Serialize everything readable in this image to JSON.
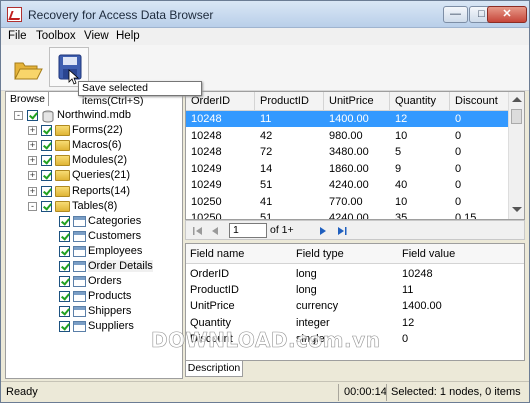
{
  "window": {
    "title": "Recovery for Access Data Browser"
  },
  "menu": [
    "File",
    "Toolbox",
    "View",
    "Help"
  ],
  "toolbar": {
    "tooltip": "Save selected items(Ctrl+S)"
  },
  "left_panel": {
    "tab": "Browse",
    "root": "Northwind.mdb",
    "groups": [
      "Forms(22)",
      "Macros(6)",
      "Modules(2)",
      "Queries(21)",
      "Reports(14)",
      "Tables(8)"
    ],
    "tables": [
      "Categories",
      "Customers",
      "Employees",
      "Order Details",
      "Orders",
      "Products",
      "Shippers",
      "Suppliers"
    ]
  },
  "grid": {
    "columns": [
      "OrderID",
      "ProductID",
      "UnitPrice",
      "Quantity",
      "Discount"
    ],
    "rows": [
      [
        "10248",
        "11",
        "1400.00",
        "12",
        "0"
      ],
      [
        "10248",
        "42",
        "980.00",
        "10",
        "0"
      ],
      [
        "10248",
        "72",
        "3480.00",
        "5",
        "0"
      ],
      [
        "10249",
        "14",
        "1860.00",
        "9",
        "0"
      ],
      [
        "10249",
        "51",
        "4240.00",
        "40",
        "0"
      ],
      [
        "10250",
        "41",
        "770.00",
        "10",
        "0"
      ],
      [
        "10250",
        "51",
        "4240.00",
        "35",
        "0.15"
      ]
    ]
  },
  "pager": {
    "page": "1",
    "of_label": "of 1+"
  },
  "fields": {
    "headers": [
      "Field name",
      "Field type",
      "Field value"
    ],
    "rows": [
      [
        "OrderID",
        "long",
        "10248"
      ],
      [
        "ProductID",
        "long",
        "11"
      ],
      [
        "UnitPrice",
        "currency",
        "1400.00"
      ],
      [
        "Quantity",
        "integer",
        "12"
      ],
      [
        "Discount",
        "single",
        "0"
      ]
    ]
  },
  "bottom_tab": "Description",
  "status": {
    "left": "Ready",
    "time": "00:00:14",
    "selection": "Selected: 1 nodes, 0 items"
  },
  "watermark": "DOWNLOAD.com.vn"
}
